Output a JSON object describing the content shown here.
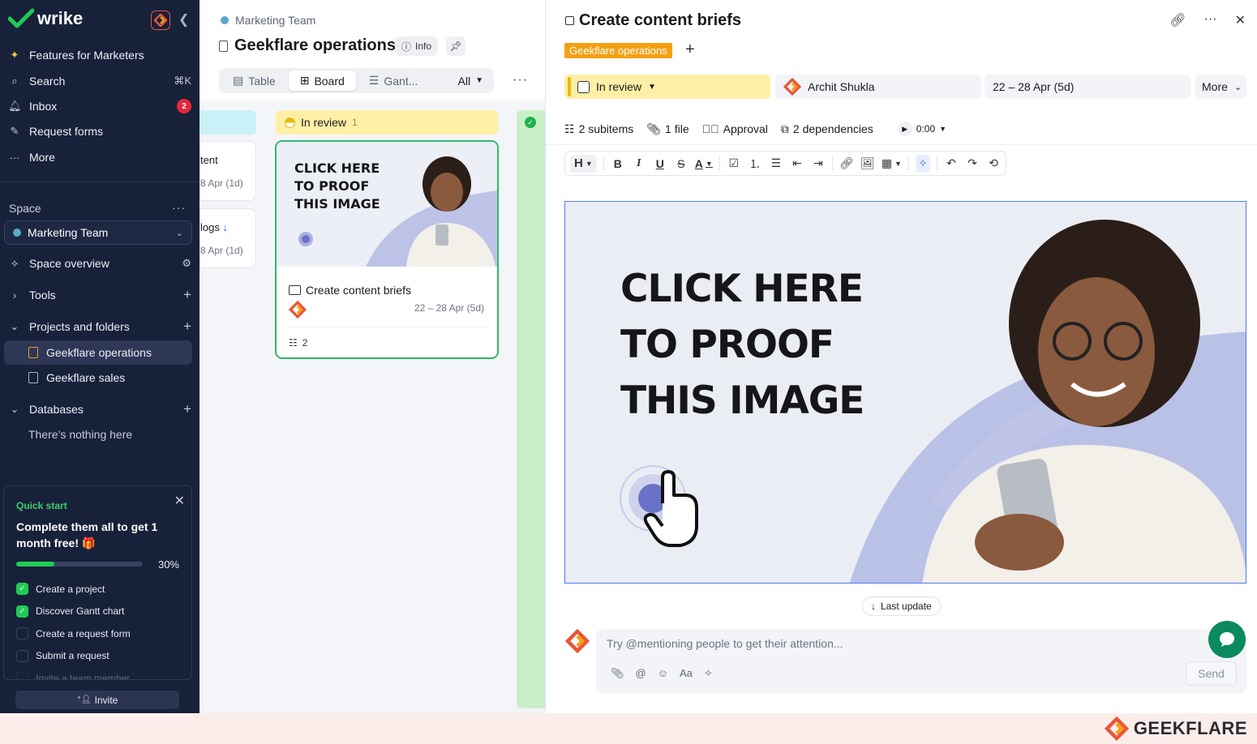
{
  "sidebar": {
    "brand": "wrike",
    "nav": [
      {
        "icon": "sparkle-icon",
        "label": "Features for Marketers",
        "right": ""
      },
      {
        "icon": "search-icon",
        "label": "Search",
        "right": "⌘K"
      },
      {
        "icon": "bell-icon",
        "label": "Inbox",
        "right": "2"
      },
      {
        "icon": "form-icon",
        "label": "Request forms",
        "right": ""
      },
      {
        "icon": "more-icon",
        "label": "More",
        "right": ""
      }
    ],
    "space_label": "Space",
    "space_name": "Marketing Team",
    "space_overview": "Space overview",
    "tools": "Tools",
    "projects_folders": "Projects and folders",
    "folders": [
      "Geekflare operations",
      "Geekflare sales"
    ],
    "databases": "Databases",
    "databases_empty": "There’s nothing here",
    "quick_start": {
      "title": "Quick start",
      "heading": "Complete them all to get 1 month free! 🎁",
      "progress": 30,
      "progress_label": "30%",
      "tasks": [
        {
          "label": "Create a project",
          "done": true
        },
        {
          "label": "Discover Gantt chart",
          "done": true
        },
        {
          "label": "Create a request form",
          "done": false
        },
        {
          "label": "Submit a request",
          "done": false
        },
        {
          "label": "Invite a team member",
          "done": false
        }
      ]
    },
    "invite": "Invite"
  },
  "board": {
    "breadcrumb": "Marketing Team",
    "title": "Geekflare operations",
    "info": "Info",
    "views": [
      "Table",
      "Board",
      "Gant..."
    ],
    "filter": "All",
    "partial_cards": [
      {
        "title": "tent",
        "date": "8 Apr (1d)"
      },
      {
        "title": "logs",
        "date": "8 Apr (1d)"
      }
    ],
    "column_in_review": {
      "label": "In review",
      "count": "1"
    },
    "card": {
      "image_text": [
        "CLICK HERE",
        "TO PROOF",
        "THIS IMAGE"
      ],
      "title": "Create content briefs",
      "date": "22 – 28 Apr (5d)",
      "subitems": "2"
    }
  },
  "panel": {
    "title": "Create content briefs",
    "tag": "Geekflare operations",
    "status": "In review",
    "assignee": "Archit Shukla",
    "dates": "22 – 28 Apr (5d)",
    "more": "More",
    "meta": {
      "subitems": "2 subitems",
      "files": "1 file",
      "approval": "Approval",
      "dependencies": "2 dependencies",
      "timer": "0:00"
    },
    "image_text": [
      "CLICK HERE",
      "TO PROOF",
      "THIS IMAGE"
    ],
    "last_update": "Last update",
    "comment_placeholder": "Try @mentioning people to get their attention...",
    "send": "Send"
  },
  "watermark": "GEEKFLARE",
  "colors": {
    "sidebar": "#18213a",
    "accent_green": "#2fb86a",
    "status_yellow": "#fdf0a6",
    "tag_orange": "#f5a012"
  }
}
